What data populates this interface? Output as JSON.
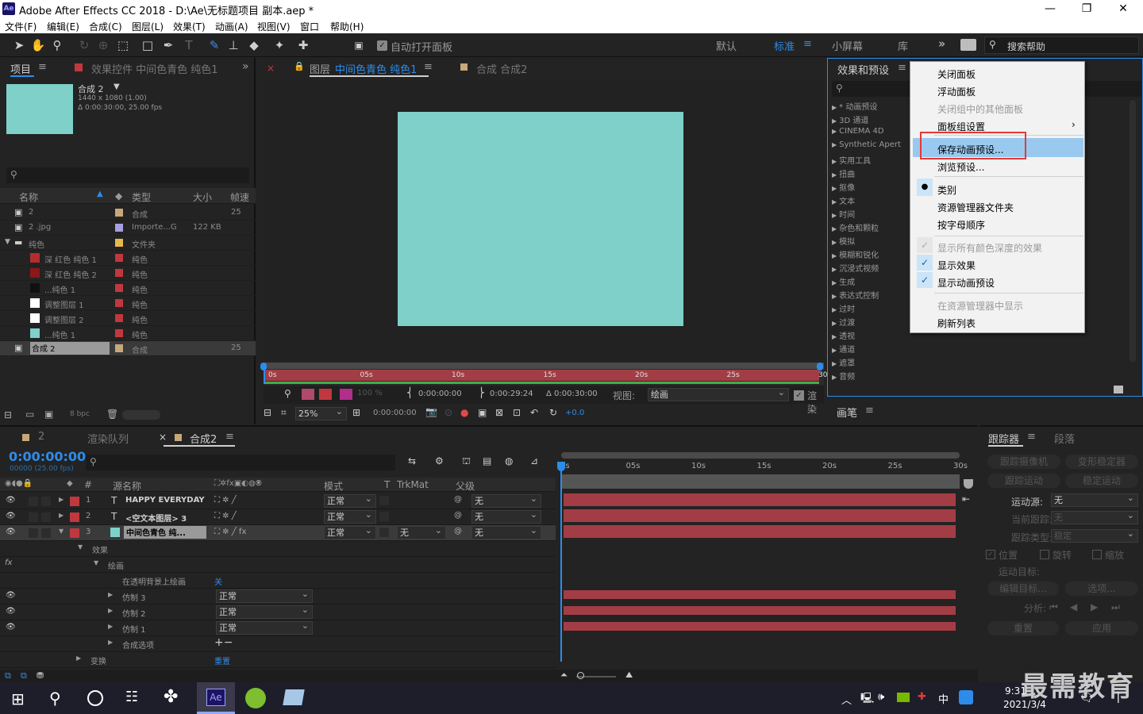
{
  "window": {
    "title": "Adobe After Effects CC 2018 - D:\\Ae\\无标题项目 副本.aep *",
    "app_icon": "Ae"
  },
  "menu": [
    "文件(F)",
    "编辑(E)",
    "合成(C)",
    "图层(L)",
    "效果(T)",
    "动画(A)",
    "视图(V)",
    "窗口",
    "帮助(H)"
  ],
  "toolbar": {
    "auto_open": "自动打开面板",
    "workspaces": [
      "默认",
      "标准",
      "小屏幕",
      "库"
    ],
    "search": "搜索帮助"
  },
  "project": {
    "tab": "项目",
    "effects_tab": "效果控件 中间色青色 纯色1",
    "comp_name": "合成 2",
    "comp_res": "1440 x 1080 (1.00)",
    "comp_dur": "Δ 0:00:30:00, 25.00 fps",
    "columns": [
      "名称",
      "类型",
      "大小",
      "帧速"
    ],
    "rows": [
      {
        "name": "2",
        "type": "合成",
        "size": "",
        "fps": "25",
        "color": "#c8a77a",
        "icon": "comp-icon"
      },
      {
        "name": "2 .jpg",
        "type": "Importe...G",
        "size": "122 KB",
        "fps": "",
        "color": "#a99ee0",
        "icon": "image-icon"
      },
      {
        "name": "纯色",
        "type": "文件夹",
        "size": "",
        "fps": "",
        "color": "#e8b84a",
        "icon": "folder-icon"
      },
      {
        "name": "深 红色 纯色 1",
        "type": "纯色",
        "size": "",
        "fps": "",
        "color": "#c0383e",
        "swatch": "#b22d2d"
      },
      {
        "name": "深 红色 纯色 2",
        "type": "纯色",
        "size": "",
        "fps": "",
        "color": "#c0383e",
        "swatch": "#8a1818"
      },
      {
        "name": "...纯色 1",
        "type": "纯色",
        "size": "",
        "fps": "",
        "color": "#c0383e",
        "swatch": "#111111"
      },
      {
        "name": "调整图层 1",
        "type": "纯色",
        "size": "",
        "fps": "",
        "color": "#c0383e",
        "swatch": "#ffffff"
      },
      {
        "name": "调整图层 2",
        "type": "纯色",
        "size": "",
        "fps": "",
        "color": "#c0383e",
        "swatch": "#ffffff"
      },
      {
        "name": "...纯色 1",
        "type": "纯色",
        "size": "",
        "fps": "",
        "color": "#c0383e",
        "swatch": "#7ed0c9"
      },
      {
        "name": "合成 2",
        "type": "合成",
        "size": "",
        "fps": "25",
        "color": "#c8a77a",
        "icon": "comp-icon"
      }
    ],
    "bpc": "8 bpc"
  },
  "viewer": {
    "layer_tab": "图层",
    "layer_name": "中间色青色 纯色1",
    "comp_tab": "合成 合成2",
    "ruler": [
      "0s",
      "05s",
      "10s",
      "15s",
      "20s",
      "25s",
      "30s"
    ],
    "opacity": "100 %",
    "in": "0:00:00:00",
    "out": "0:00:29:24",
    "dur": "Δ 0:00:30:00",
    "view_label": "视图:",
    "view_value": "绘画",
    "render": "渲染",
    "zoom": "25%",
    "time": "0:00:00:00",
    "exposure": "+0.0",
    "solid_color": "#7ed0c9"
  },
  "effects": {
    "title": "效果和预设",
    "items": [
      "* 动画预设",
      "3D 通道",
      "CINEMA 4D",
      "Synthetic Apert",
      "实用工具",
      "扭曲",
      "抠像",
      "文本",
      "时间",
      "杂色和颗粒",
      "模拟",
      "模糊和锐化",
      "沉浸式视频",
      "生成",
      "表达式控制",
      "过时",
      "过渡",
      "透视",
      "通道",
      "遮罩",
      "音频"
    ],
    "paint_tab": "画笔"
  },
  "context_menu": {
    "items": [
      {
        "label": "关闭面板",
        "disabled": false
      },
      {
        "label": "浮动面板",
        "disabled": false
      },
      {
        "label": "关闭组中的其他面板",
        "disabled": true
      },
      {
        "label": "面板组设置",
        "disabled": false,
        "submenu": true
      },
      {
        "label": "保存动画预设...",
        "disabled": false,
        "highlight": true
      },
      {
        "label": "浏览预设...",
        "disabled": false
      },
      {
        "label": "类别",
        "disabled": false,
        "bullet": true
      },
      {
        "label": "资源管理器文件夹",
        "disabled": false
      },
      {
        "label": "按字母顺序",
        "disabled": false
      },
      {
        "label": "显示所有颜色深度的效果",
        "disabled": true,
        "check": true
      },
      {
        "label": "显示效果",
        "disabled": false,
        "check": true
      },
      {
        "label": "显示动画预设",
        "disabled": false,
        "check": true
      },
      {
        "label": "在资源管理器中显示",
        "disabled": true
      },
      {
        "label": "刷新列表",
        "disabled": false
      }
    ]
  },
  "timeline": {
    "tabs": [
      "2",
      "渲染队列",
      "合成2"
    ],
    "timecode": "0:00:00:00",
    "fps_sub": "00000 (25.00 fps)",
    "cols": [
      "#",
      "源名称",
      "模式",
      "T",
      "TrkMat",
      "父级"
    ],
    "ruler": [
      "0s",
      "05s",
      "10s",
      "15s",
      "20s",
      "25s",
      "30s"
    ],
    "layers": [
      {
        "num": "1",
        "type": "T",
        "name": "HAPPY EVERYDAY",
        "mode": "正常",
        "parent": "无",
        "trk": ""
      },
      {
        "num": "2",
        "type": "T",
        "name": "<空文本图层> 3",
        "mode": "正常",
        "parent": "无",
        "trk": ""
      },
      {
        "num": "3",
        "type": "",
        "name": "中间色青色 纯...",
        "mode": "正常",
        "parent": "无",
        "trk": "无"
      }
    ],
    "props": {
      "effects": "效果",
      "paint": "绘画",
      "on_transparent": "在透明背景上绘画",
      "on_transparent_value": "关",
      "strokes": [
        {
          "name": "仿制 3",
          "mode": "正常"
        },
        {
          "name": "仿制 2",
          "mode": "正常"
        },
        {
          "name": "仿制 1",
          "mode": "正常"
        }
      ],
      "composite": "合成选项",
      "transform": "变换",
      "reset": "重置"
    }
  },
  "tracker": {
    "tabs": [
      "跟踪器",
      "段落"
    ],
    "buttons": [
      "跟踪摄像机",
      "变形稳定器",
      "跟踪运动",
      "稳定运动"
    ],
    "motion_source_label": "运动源:",
    "motion_source": "无",
    "current_track_label": "当前跟踪:",
    "current_track": "无",
    "track_type_label": "跟踪类型:",
    "track_type": "稳定",
    "checks": [
      "位置",
      "旋转",
      "缩放"
    ],
    "target_label": "运动目标:",
    "edit_target": "编辑目标...",
    "options": "选项...",
    "analyze": "分析:",
    "reset": "重置",
    "apply": "应用"
  },
  "taskbar": {
    "time": "9:31",
    "date": "2021/3/4",
    "ime": "中",
    "watermark": "最需教育"
  }
}
